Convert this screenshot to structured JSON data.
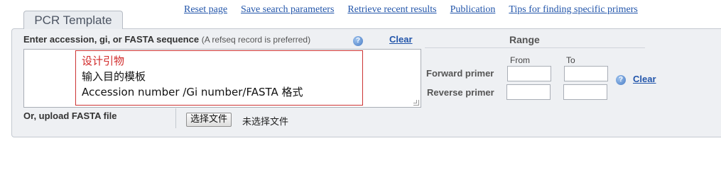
{
  "top_links": [
    "Reset page",
    "Save search parameters",
    "Retrieve recent results",
    "Publication",
    "Tips for finding specific primers"
  ],
  "tab": {
    "label": "PCR Template"
  },
  "sequence": {
    "label": "Enter accession, gi, or FASTA sequence",
    "hint": "(A refseq record is preferred)",
    "clear": "Clear",
    "value": ""
  },
  "annotation": {
    "line1": "设计引物",
    "line2": "输入目的模板",
    "line3": "Accession number /Gi number/FASTA 格式"
  },
  "upload": {
    "label": "Or, upload FASTA file",
    "button": "选择文件",
    "status": "未选择文件"
  },
  "range": {
    "title": "Range",
    "from_label": "From",
    "to_label": "To",
    "forward_label": "Forward primer",
    "reverse_label": "Reverse primer",
    "forward_from": "",
    "forward_to": "",
    "reverse_from": "",
    "reverse_to": "",
    "clear": "Clear"
  },
  "icons": {
    "help": "help-icon",
    "resize": "resize-grip-icon"
  },
  "colors": {
    "link": "#2255aa",
    "annotation_border": "#cc3333",
    "annotation_title": "#d12a2a",
    "panel_bg": "#eef0f3"
  }
}
